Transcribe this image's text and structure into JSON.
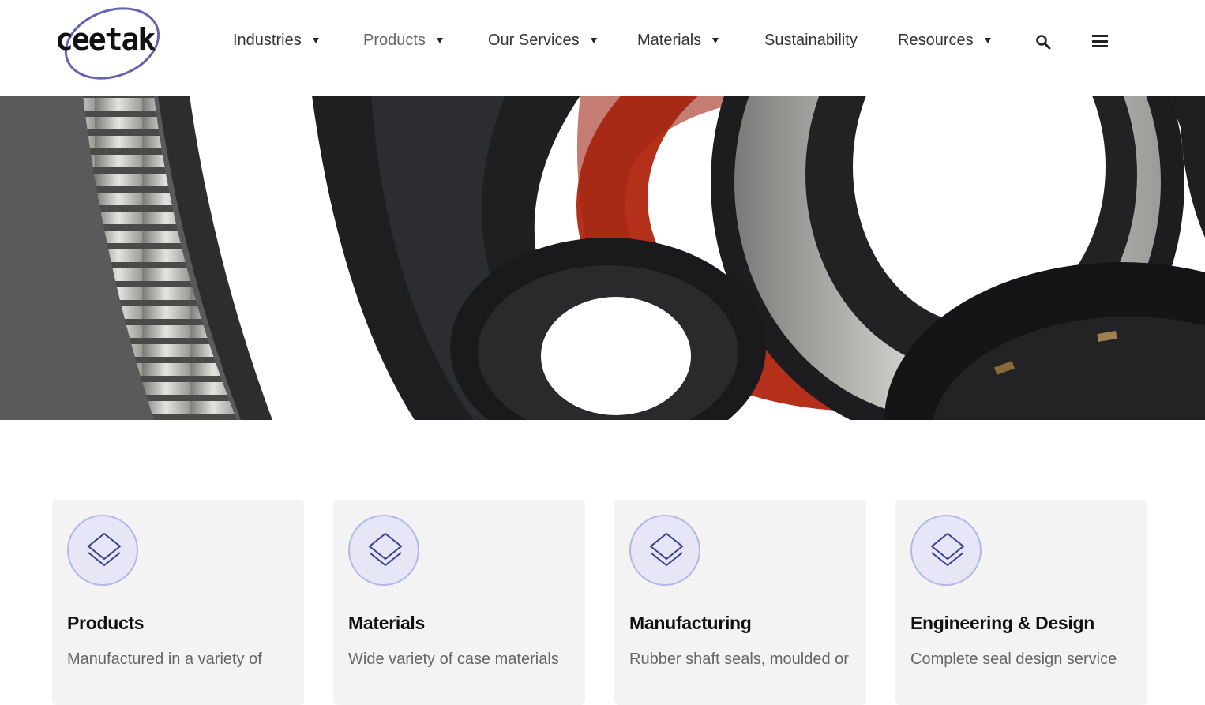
{
  "brand": {
    "logo_text": "ceetak"
  },
  "nav": {
    "items": [
      {
        "label": "Industries",
        "has_dropdown": true
      },
      {
        "label": "Products",
        "has_dropdown": true,
        "active": true
      },
      {
        "label": "Our Services",
        "has_dropdown": true
      },
      {
        "label": "Materials",
        "has_dropdown": true
      },
      {
        "label": "Sustainability",
        "has_dropdown": false
      },
      {
        "label": "Resources",
        "has_dropdown": true
      }
    ],
    "search_icon": "search-icon",
    "menu_icon": "hamburger-menu-icon"
  },
  "hero": {
    "image": "assorted rubber shaft seals"
  },
  "cards": [
    {
      "title": "Products",
      "text": "Manufactured in a variety of",
      "icon": "layers-icon"
    },
    {
      "title": "Materials",
      "text": "Wide variety of case materials",
      "icon": "layers-icon"
    },
    {
      "title": "Manufacturing",
      "text": "Rubber shaft seals, moulded or",
      "icon": "layers-icon"
    },
    {
      "title": "Engineering & Design",
      "text": "Complete seal design service",
      "icon": "layers-icon"
    }
  ],
  "colors": {
    "accent": "#b5b7e6",
    "icon_stroke": "#3d3f8f",
    "seal_red": "#b5301b",
    "card_bg": "#f3f3f4"
  }
}
